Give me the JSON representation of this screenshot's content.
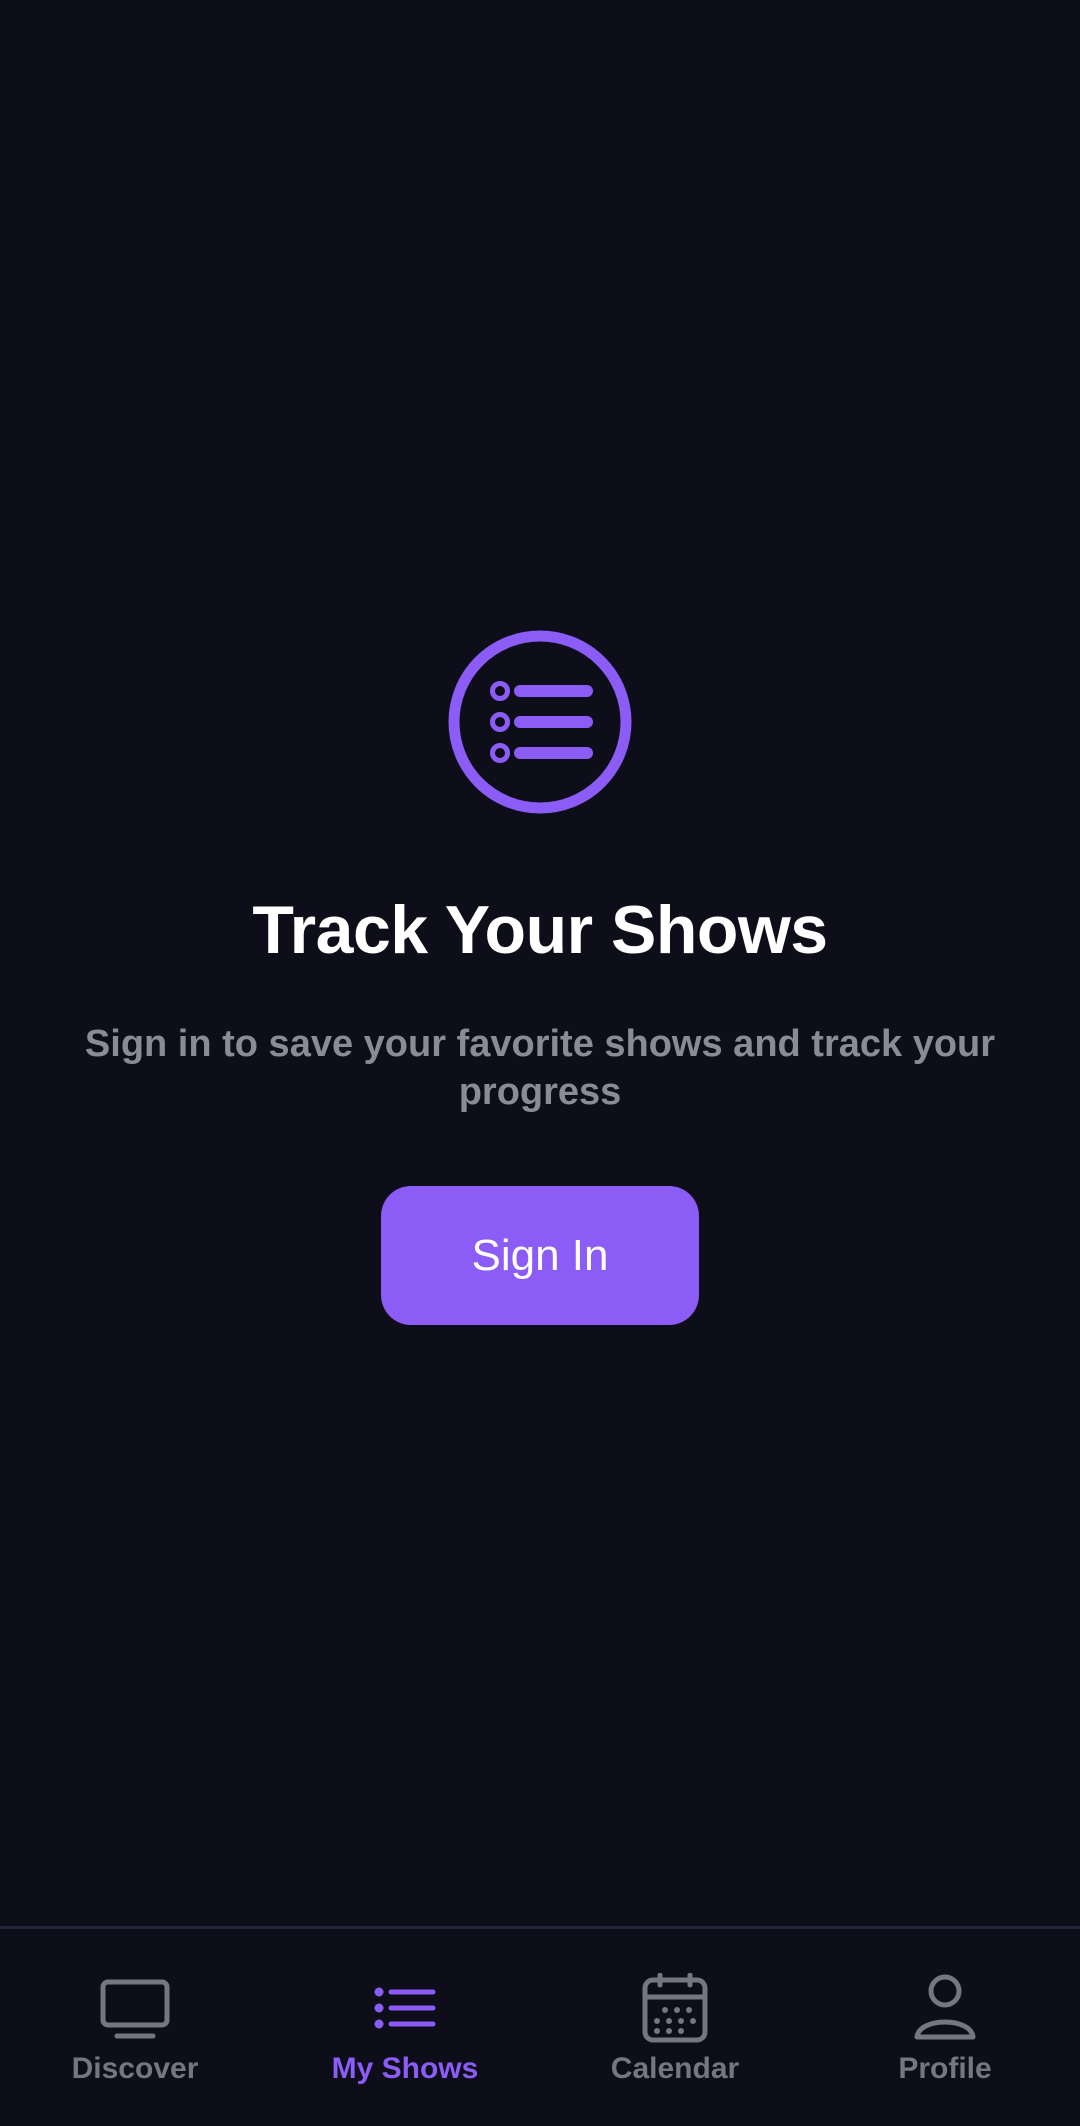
{
  "colors": {
    "background": "#0e0e1a",
    "accent": "#8b5cf6",
    "title": "#ffffff",
    "muted": "#8b8b93",
    "inactive_tab": "#76767e"
  },
  "empty_state": {
    "icon": "list-circle-icon",
    "title": "Track Your Shows",
    "subtitle": "Sign in to save your favorite shows and track your progress",
    "button_label": "Sign In"
  },
  "tabbar": {
    "active": "my_shows",
    "tabs": [
      {
        "id": "discover",
        "label": "Discover",
        "icon": "tv-icon"
      },
      {
        "id": "my_shows",
        "label": "My Shows",
        "icon": "list-icon"
      },
      {
        "id": "calendar",
        "label": "Calendar",
        "icon": "calendar-icon"
      },
      {
        "id": "profile",
        "label": "Profile",
        "icon": "person-icon"
      }
    ]
  }
}
